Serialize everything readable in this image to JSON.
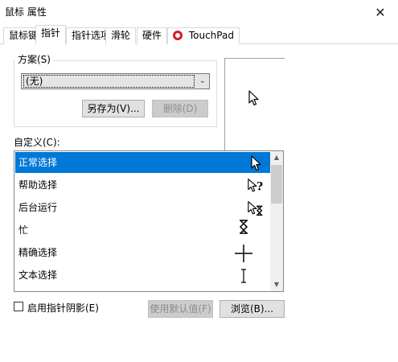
{
  "window": {
    "title": "鼠标 属性",
    "close_glyph": "✕"
  },
  "tabs": [
    {
      "label": "鼠标键"
    },
    {
      "label": "指针"
    },
    {
      "label": "指针选项"
    },
    {
      "label": "滑轮"
    },
    {
      "label": "硬件"
    },
    {
      "label": "TouchPad",
      "icon": "touchpad-logo-icon",
      "icon_color": "#d71c26"
    }
  ],
  "scheme": {
    "label": "方案(S)",
    "selected": "(无)",
    "save_as_label": "另存为(V)...",
    "delete_label": "删除(D)"
  },
  "customize": {
    "label": "自定义(C):",
    "items": [
      {
        "label": "正常选择",
        "icon": "arrow-cursor-icon",
        "selected": true
      },
      {
        "label": "帮助选择",
        "icon": "help-cursor-icon"
      },
      {
        "label": "后台运行",
        "icon": "working-in-background-cursor-icon"
      },
      {
        "label": "忙",
        "icon": "busy-hourglass-icon"
      },
      {
        "label": "精确选择",
        "icon": "crosshair-cursor-icon"
      },
      {
        "label": "文本选择",
        "icon": "text-ibeam-cursor-icon"
      }
    ]
  },
  "options": {
    "shadow_label": "启用指针阴影(E)",
    "shadow_checked": false,
    "use_default_label": "使用默认值(F)",
    "browse_label": "浏览(B)..."
  },
  "colors": {
    "selection": "#0078d7",
    "accent_tab_icon": "#d71c26"
  }
}
